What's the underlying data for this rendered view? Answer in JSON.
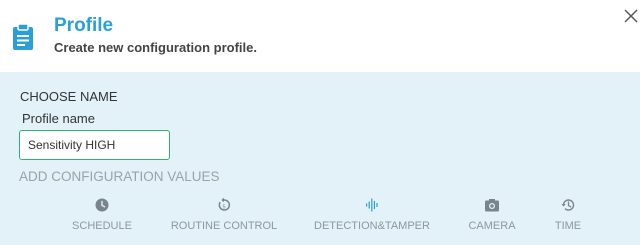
{
  "header": {
    "title": "Profile",
    "subtitle": "Create new configuration profile.",
    "icon": "clipboard-icon",
    "icon_color": "#2a9fd8"
  },
  "colors": {
    "accent": "#2a9fd8",
    "panel_bg": "#e2f2f8",
    "input_border": "#2db36a",
    "tab_icon": "#7a848c",
    "tab_active_icon": "#2a9fd8"
  },
  "choose_name": {
    "heading": "CHOOSE NAME",
    "label": "Profile name",
    "value": "Sensitivity HIGH"
  },
  "config": {
    "heading": "ADD CONFIGURATION VALUES",
    "tabs": [
      {
        "label": "SCHEDULE",
        "icon": "clock-icon"
      },
      {
        "label": "ROUTINE CONTROL",
        "icon": "routine-icon"
      },
      {
        "label": "DETECTION&TAMPER",
        "icon": "waveform-icon",
        "active": true
      },
      {
        "label": "CAMERA",
        "icon": "camera-icon"
      },
      {
        "label": "TIME",
        "icon": "history-icon"
      }
    ]
  }
}
